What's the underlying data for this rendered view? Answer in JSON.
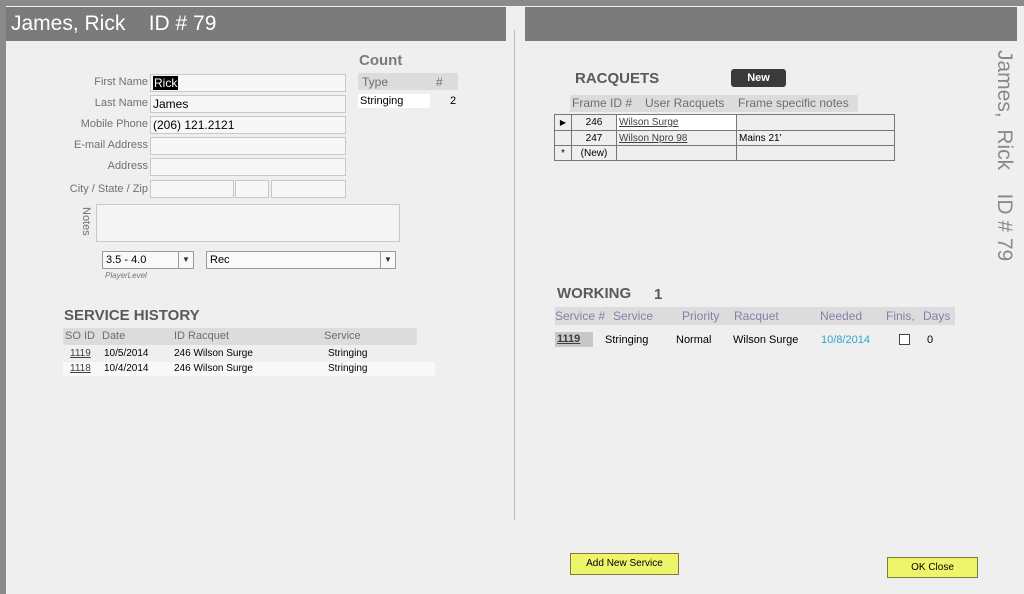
{
  "header": {
    "title": "James, Rick    ID # 79",
    "vertical_title": "James,  Rick    ID # 79"
  },
  "person": {
    "labels": {
      "first_name": "First Name",
      "last_name": "Last Name",
      "mobile": "Mobile Phone",
      "email": "E-mail Address",
      "address": "Address",
      "city_state_zip": "City / State / Zip",
      "notes": "Notes",
      "player_level": "PlayerLevel"
    },
    "values": {
      "first_name": "Rick",
      "last_name": "James",
      "mobile": "(206) 121.2121",
      "email": "",
      "address": "",
      "city": "",
      "state": "",
      "zip": "",
      "notes": "",
      "player_level": "3.5 - 4.0",
      "play_type": "Rec"
    }
  },
  "count": {
    "title": "Count",
    "headers": [
      "Type",
      "#"
    ],
    "rows": [
      {
        "type": "Stringing",
        "count": "2"
      }
    ]
  },
  "service_history": {
    "title": "SERVICE HISTORY",
    "headers": [
      "SO ID",
      "Date",
      "ID Racquet",
      "Service"
    ],
    "rows": [
      {
        "so_id": "1119",
        "date": "10/5/2014",
        "racquet": "246 Wilson Surge",
        "service": "Stringing"
      },
      {
        "so_id": "1118",
        "date": "10/4/2014",
        "racquet": "246 Wilson Surge",
        "service": "Stringing"
      }
    ]
  },
  "racquets": {
    "title": "RACQUETS",
    "new_button": "New",
    "headers": [
      "Frame ID #",
      "User Racquets",
      "Frame specific notes"
    ],
    "rows": [
      {
        "selector": "▶",
        "frame_id": "246",
        "name": "Wilson Surge",
        "notes": ""
      },
      {
        "selector": "",
        "frame_id": "247",
        "name": "Wilson Npro 98",
        "notes": "Mains 21'"
      },
      {
        "selector": "*",
        "frame_id": "(New)",
        "name": "",
        "notes": ""
      }
    ]
  },
  "working": {
    "title": "WORKING",
    "count": "1",
    "headers": [
      "Service #",
      "Service",
      "Priority",
      "Racquet",
      "Needed",
      "Finis,",
      "Days"
    ],
    "rows": [
      {
        "service_no": "1119",
        "service": "Stringing",
        "priority": "Normal",
        "racquet": "Wilson Surge",
        "needed": "10/8/2014",
        "finished": false,
        "days": "0"
      }
    ]
  },
  "buttons": {
    "add_service": "Add New Service",
    "ok_close": "OK Close"
  },
  "colors": {
    "header_bg": "#7b7b7b",
    "form_bg": "#efefef",
    "accent_button": "#eef56b",
    "link_blue": "#2aa7c9",
    "header_purple": "#8c7ca8"
  }
}
